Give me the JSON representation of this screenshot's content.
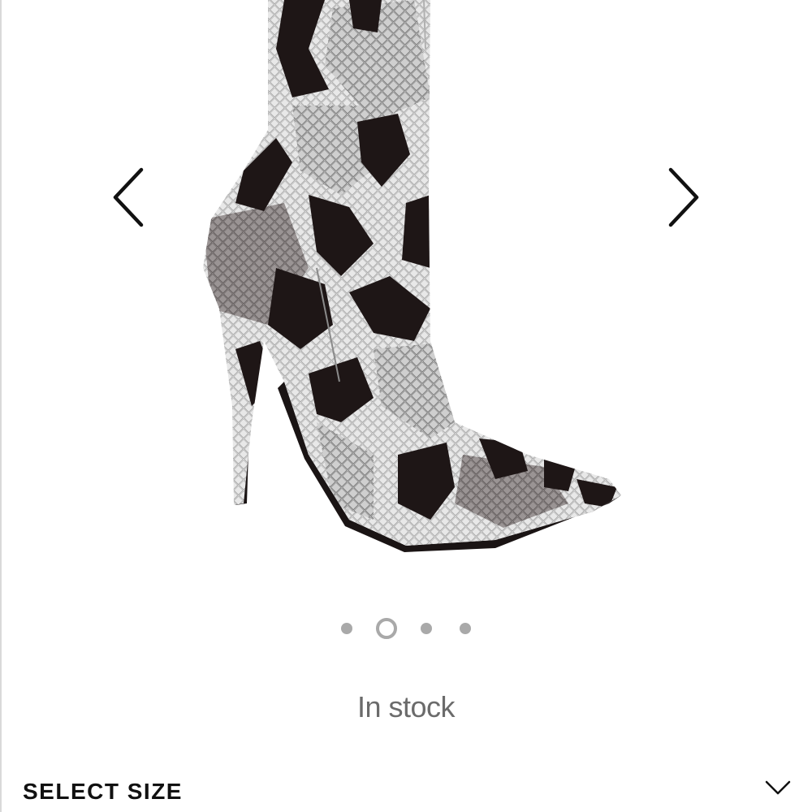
{
  "gallery": {
    "image_alt": "Snakeskin print pointed-toe stiletto boot",
    "prev_icon": "chevron-left-icon",
    "next_icon": "chevron-right-icon",
    "total_images": 4,
    "active_index": 1
  },
  "stock": {
    "status": "In stock"
  },
  "size_selector": {
    "label": "SELECT SIZE",
    "icon": "chevron-down-icon"
  },
  "colors": {
    "status_text": "#6b6b6b",
    "dot": "#a9a9a9",
    "heading": "#111111"
  }
}
